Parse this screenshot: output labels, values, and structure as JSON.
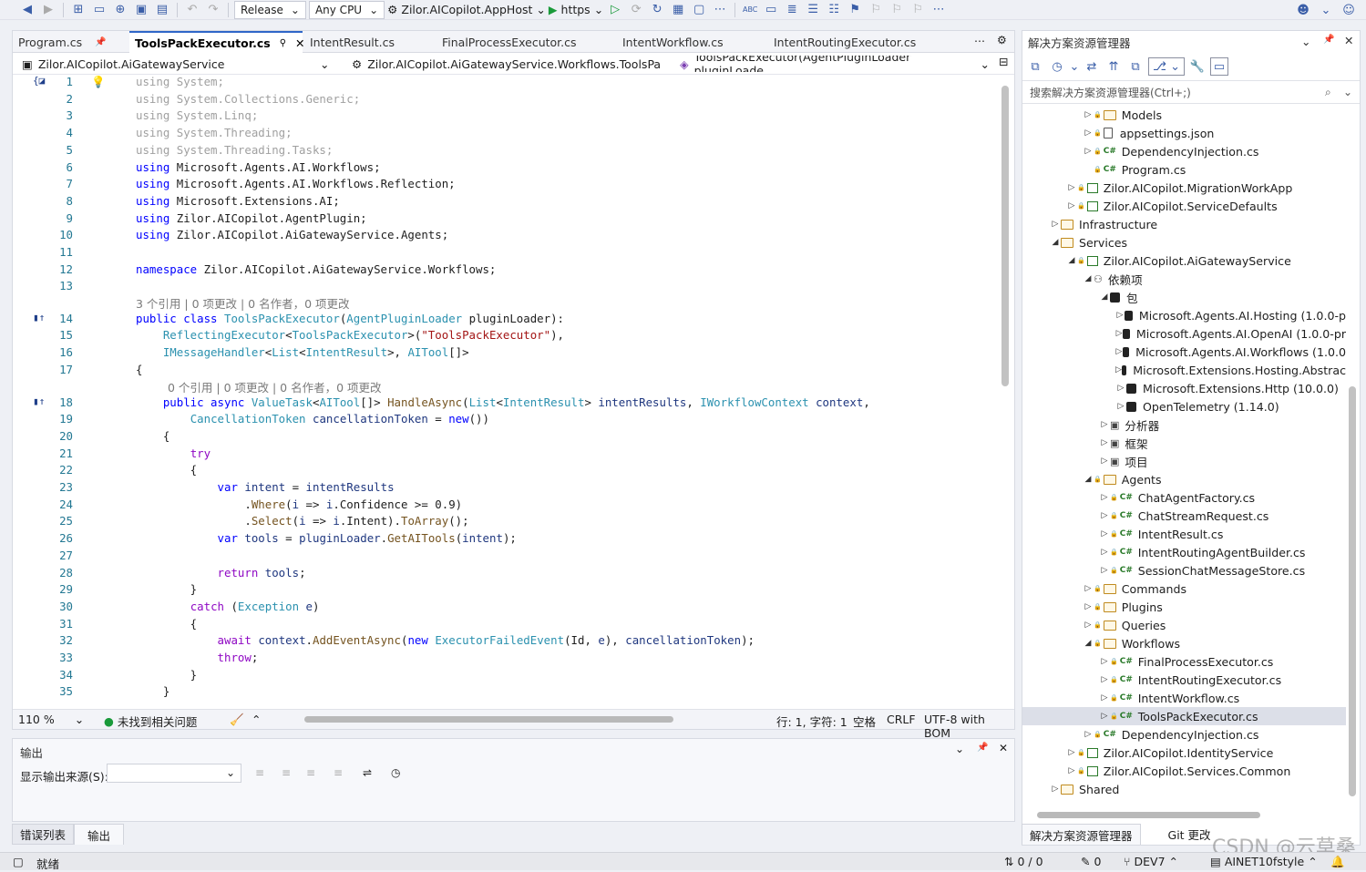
{
  "toolbar": {
    "config": "Release",
    "platform": "Any CPU",
    "startup": "Zilor.AICopilot.AppHost",
    "run_profile": "https"
  },
  "editor": {
    "tabs": [
      {
        "label": "Program.cs",
        "active": false
      },
      {
        "label": "ToolsPackExecutor.cs",
        "active": true
      },
      {
        "label": "IntentResult.cs",
        "active": false
      },
      {
        "label": "FinalProcessExecutor.cs",
        "active": false
      },
      {
        "label": "IntentWorkflow.cs",
        "active": false
      },
      {
        "label": "IntentRoutingExecutor.cs",
        "active": false
      }
    ],
    "nav": {
      "project": "Zilor.AICopilot.AiGatewayService",
      "type": "Zilor.AICopilot.AiGatewayService.Workflows.ToolsPa",
      "member": "ToolsPackExecutor(AgentPluginLoader pluginLoade"
    },
    "hint_class": "3 个引用 | 0 项更改 | 0 名作者，0 项更改",
    "hint_method": "0 个引用 | 0 项更改 | 0 名作者，0 项更改",
    "string_literal": "\"ToolsPackExecutor\"",
    "status": {
      "zoom": "110 %",
      "issues": "未找到相关问题",
      "position": "行: 1, 字符: 1",
      "whitespace": "空格",
      "eol": "CRLF",
      "encoding": "UTF-8 with BOM"
    }
  },
  "output": {
    "title": "输出",
    "source_label": "显示输出来源(S):"
  },
  "bottom_tabs": [
    "错误列表",
    "输出"
  ],
  "solution": {
    "title": "解决方案资源管理器",
    "search_placeholder": "搜索解决方案资源管理器(Ctrl+;)",
    "items": [
      {
        "label": "Models",
        "kind": "folder"
      },
      {
        "label": "appsettings.json",
        "kind": "json"
      },
      {
        "label": "DependencyInjection.cs",
        "kind": "cs"
      },
      {
        "label": "Program.cs",
        "kind": "cs"
      },
      {
        "label": "Zilor.AICopilot.MigrationWorkApp",
        "kind": "project"
      },
      {
        "label": "Zilor.AICopilot.ServiceDefaults",
        "kind": "project"
      },
      {
        "label": "Infrastructure",
        "kind": "folder"
      },
      {
        "label": "Services",
        "kind": "folder"
      },
      {
        "label": "Zilor.AICopilot.AiGatewayService",
        "kind": "project"
      },
      {
        "label": "依赖项",
        "kind": "deps"
      },
      {
        "label": "包",
        "kind": "pkg"
      },
      {
        "label": "Microsoft.Agents.AI.Hosting (1.0.0-p",
        "kind": "pkg"
      },
      {
        "label": "Microsoft.Agents.AI.OpenAI (1.0.0-pr",
        "kind": "pkg"
      },
      {
        "label": "Microsoft.Agents.AI.Workflows (1.0.0",
        "kind": "pkg"
      },
      {
        "label": "Microsoft.Extensions.Hosting.Abstrac",
        "kind": "pkg"
      },
      {
        "label": "Microsoft.Extensions.Http (10.0.0)",
        "kind": "pkg"
      },
      {
        "label": "OpenTelemetry (1.14.0)",
        "kind": "pkg"
      },
      {
        "label": "分析器",
        "kind": "gen"
      },
      {
        "label": "框架",
        "kind": "gen"
      },
      {
        "label": "项目",
        "kind": "gen"
      },
      {
        "label": "Agents",
        "kind": "folder"
      },
      {
        "label": "ChatAgentFactory.cs",
        "kind": "cs"
      },
      {
        "label": "ChatStreamRequest.cs",
        "kind": "cs"
      },
      {
        "label": "IntentResult.cs",
        "kind": "cs"
      },
      {
        "label": "IntentRoutingAgentBuilder.cs",
        "kind": "cs"
      },
      {
        "label": "SessionChatMessageStore.cs",
        "kind": "cs"
      },
      {
        "label": "Commands",
        "kind": "folder"
      },
      {
        "label": "Plugins",
        "kind": "folder"
      },
      {
        "label": "Queries",
        "kind": "folder"
      },
      {
        "label": "Workflows",
        "kind": "folder"
      },
      {
        "label": "FinalProcessExecutor.cs",
        "kind": "cs"
      },
      {
        "label": "IntentRoutingExecutor.cs",
        "kind": "cs"
      },
      {
        "label": "IntentWorkflow.cs",
        "kind": "cs"
      },
      {
        "label": "ToolsPackExecutor.cs",
        "kind": "cs"
      },
      {
        "label": "DependencyInjection.cs",
        "kind": "cs"
      },
      {
        "label": "Zilor.AICopilot.IdentityService",
        "kind": "project"
      },
      {
        "label": "Zilor.AICopilot.Services.Common",
        "kind": "project"
      },
      {
        "label": "Shared",
        "kind": "folder"
      }
    ],
    "tabs": [
      "解决方案资源管理器",
      "Git 更改"
    ]
  },
  "statusbar": {
    "ready": "就绪",
    "sync": "0 / 0",
    "edits": "0",
    "branch": "DEV7",
    "repo": "AINET10fstyle"
  },
  "watermark": "CSDN @云草桑"
}
